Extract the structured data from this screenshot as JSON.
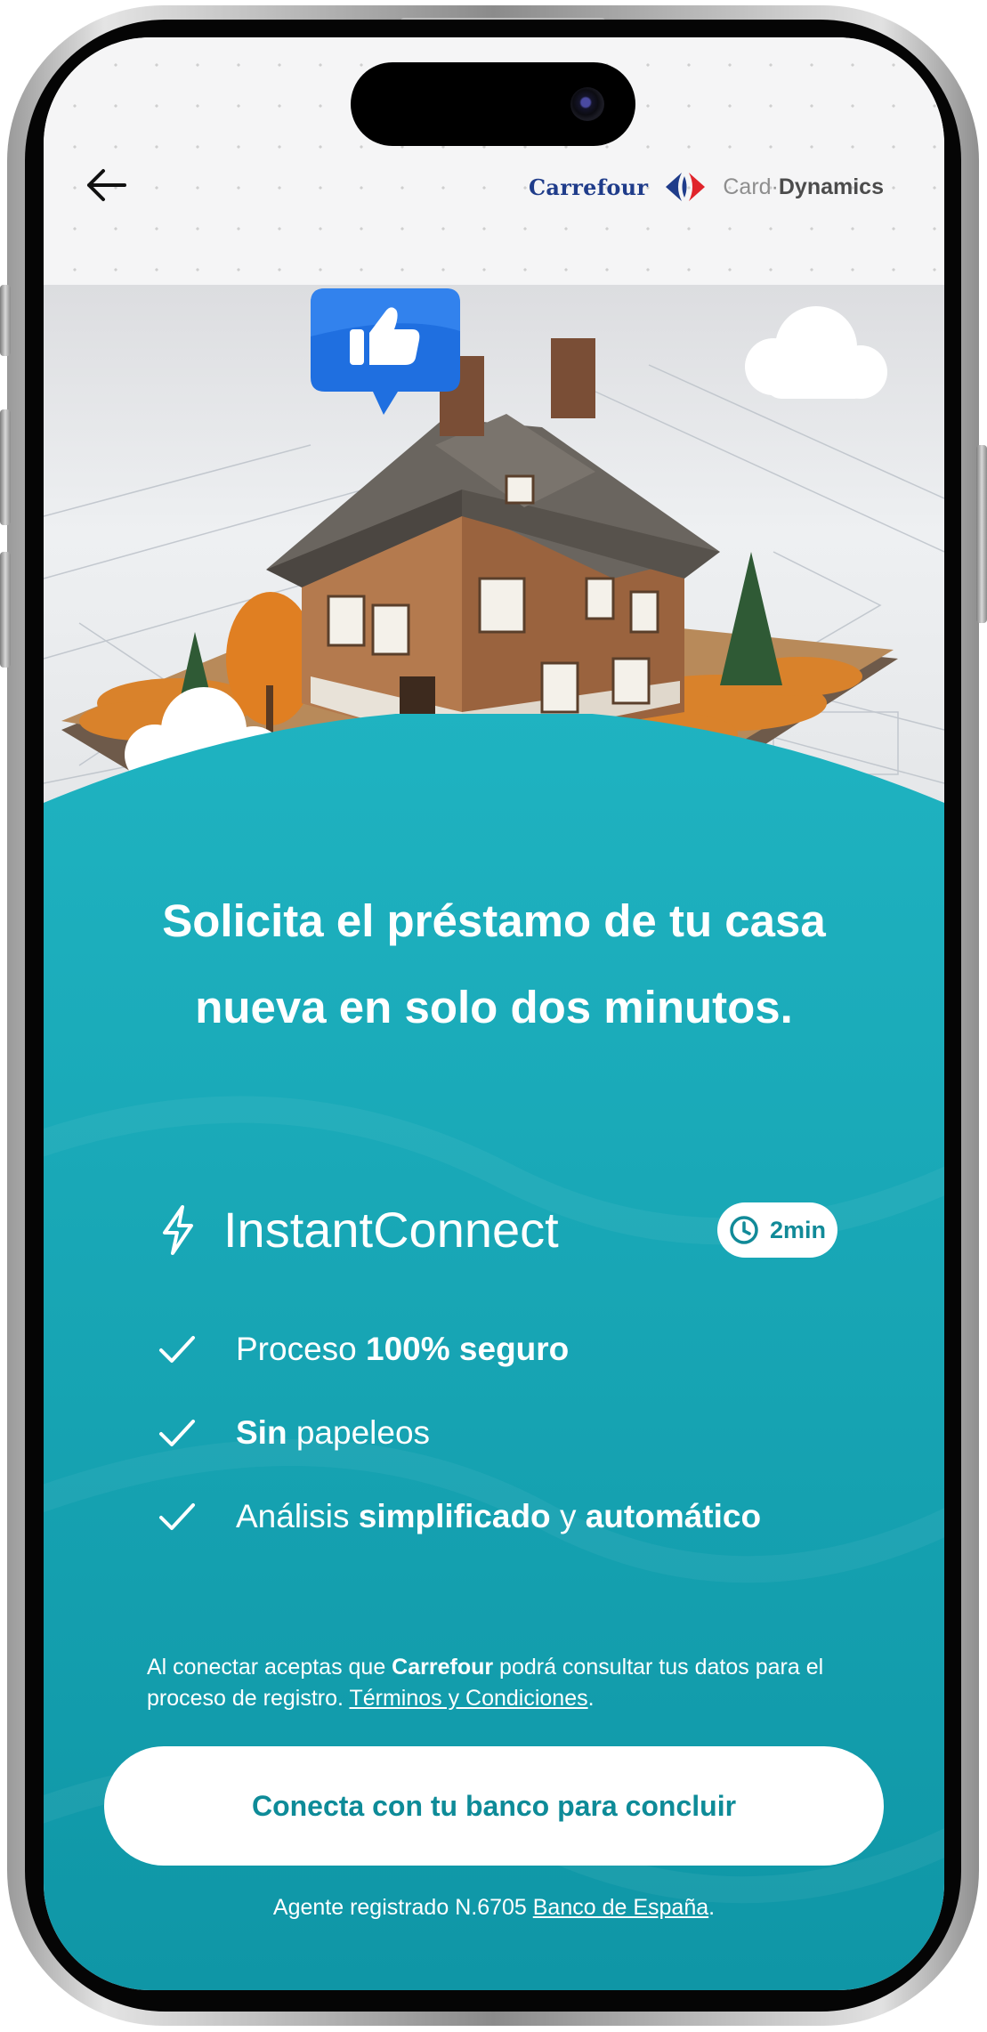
{
  "header": {
    "back_icon": "arrow-left-icon",
    "brand_carrefour": "Carrefour",
    "brand_carrefour_logo_icon": "carrefour-logo-icon",
    "brand_partner_prefix": "Card",
    "brand_partner_suffix": "Dynamics"
  },
  "hero": {
    "image": "house-on-blueprints-illustration",
    "badge_icon": "thumbs-up-icon"
  },
  "main": {
    "headline": "Solicita el préstamo de tu casa nueva en solo dos minutos.",
    "connector_icon": "lightning-bolt-icon",
    "connector_name": "InstantConnect",
    "time_badge_icon": "clock-icon",
    "time_badge": "2min",
    "features": [
      {
        "icon": "checkmark-icon",
        "parts": [
          "Proceso ",
          "100% seguro"
        ]
      },
      {
        "icon": "checkmark-icon",
        "parts": [
          "Sin",
          " papeleos"
        ]
      },
      {
        "icon": "checkmark-icon",
        "parts": [
          "Análisis ",
          "simplificado",
          " y ",
          "automático"
        ]
      }
    ]
  },
  "legal": {
    "text_1": "Al conectar aceptas que ",
    "brand": "Carrefour",
    "text_2": " podrá consultar tus datos para el proceso de registro. ",
    "terms_link": "Términos y Condiciones",
    "text_3": "."
  },
  "cta": {
    "label": "Conecta con tu banco para concluir"
  },
  "footer": {
    "agent_text": "Agente registrado N.6705 ",
    "agent_link": "Banco de España",
    "agent_end": "."
  },
  "colors": {
    "panel_top": "#1fb3c1",
    "panel_bottom": "#0f96a6",
    "cta_text": "#0e8b98",
    "carrefour_blue": "#1f3c8a",
    "badge_blue": "#1f6fe0"
  }
}
